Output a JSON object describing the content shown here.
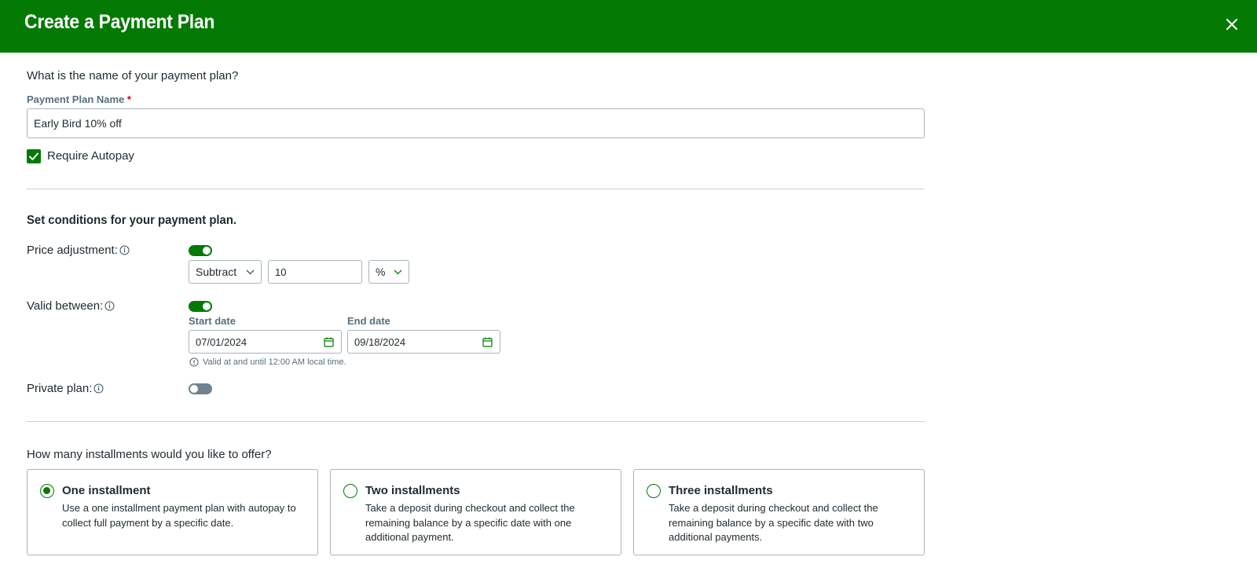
{
  "header": {
    "title": "Create a Payment Plan"
  },
  "name_section": {
    "question": "What is the name of your payment plan?",
    "field_label": "Payment Plan Name",
    "required_marker": "*",
    "value": "Early Bird 10% off",
    "autopay_label": "Require Autopay",
    "autopay_checked": true
  },
  "conditions": {
    "title": "Set conditions for your payment plan.",
    "price_adjustment": {
      "label": "Price adjustment:",
      "enabled": true,
      "operation": "Subtract",
      "amount": "10",
      "unit": "%"
    },
    "valid_between": {
      "label": "Valid between:",
      "enabled": true,
      "start_label": "Start date",
      "start_value": "07/01/2024",
      "end_label": "End date",
      "end_value": "09/18/2024",
      "hint": "Valid at and until 12:00 AM local time."
    },
    "private_plan": {
      "label": "Private plan:",
      "enabled": false
    }
  },
  "installments": {
    "question": "How many installments would you like to offer?",
    "options": [
      {
        "title": "One installment",
        "description": "Use a one installment payment plan with autopay to collect full payment by a specific date.",
        "selected": true
      },
      {
        "title": "Two installments",
        "description": "Take a deposit during checkout and collect the remaining balance by a specific date with one additional payment.",
        "selected": false
      },
      {
        "title": "Three installments",
        "description": "Take a deposit during checkout and collect the remaining balance by a specific date with two additional payments.",
        "selected": false
      }
    ]
  },
  "colors": {
    "brand_green": "#027a03",
    "label_gray": "#55707f",
    "border": "#a9b6bd",
    "required_red": "#d0021b"
  }
}
